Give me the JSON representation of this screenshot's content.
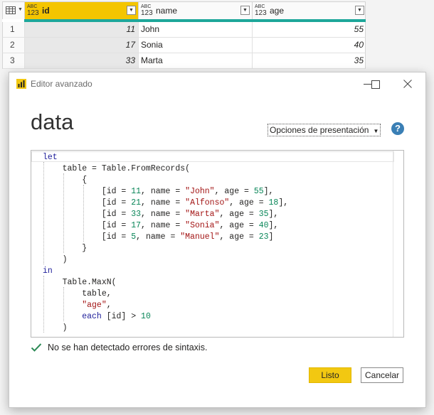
{
  "grid": {
    "columns": [
      {
        "type_top": "ABC",
        "type_bottom": "123",
        "name": "id"
      },
      {
        "type_top": "ABC",
        "type_bottom": "123",
        "name": "name"
      },
      {
        "type_top": "ABC",
        "type_bottom": "123",
        "name": "age"
      }
    ],
    "rows": [
      {
        "n": "1",
        "id": "11",
        "name": "John",
        "age": "55"
      },
      {
        "n": "2",
        "id": "17",
        "name": "Sonia",
        "age": "40"
      },
      {
        "n": "3",
        "id": "33",
        "name": "Marta",
        "age": "35"
      }
    ]
  },
  "dialog": {
    "title": "Editor avanzado",
    "query_name": "data",
    "display_options_label": "Opciones de presentación",
    "help_label": "?",
    "code_lines": [
      "let",
      "    table = Table.FromRecords(",
      "        {",
      "            [id = 11, name = \"John\", age = 55],",
      "            [id = 21, name = \"Alfonso\", age = 18],",
      "            [id = 33, name = \"Marta\", age = 35],",
      "            [id = 17, name = \"Sonia\", age = 40],",
      "            [id = 5, name = \"Manuel\", age = 23]",
      "        }",
      "    )",
      "in",
      "    Table.MaxN(",
      "        table,",
      "        \"age\",",
      "        each [id] > 10",
      "    )"
    ],
    "syntax_status": "No se han detectado errores de sintaxis.",
    "ok_label": "Listo",
    "cancel_label": "Cancelar"
  },
  "colors": {
    "accent_yellow": "#f2c811",
    "teal": "#1ea79a",
    "help_blue": "#3a7fb5",
    "check_green": "#2e8b57"
  }
}
